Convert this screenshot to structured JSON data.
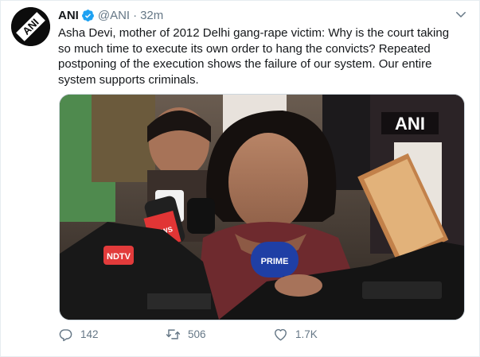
{
  "tweet": {
    "author": "ANI",
    "handle": "@ANI",
    "separator": "·",
    "time": "32m",
    "text": "Asha Devi, mother of 2012 Delhi gang-rape victim: Why is the court taking so much time to execute its own order to hang the convicts? Repeated postponing of the execution shows the failure of our system. Our entire system supports criminals.",
    "avatar_text": "ANI",
    "icons": {
      "verified": "verified-badge-icon",
      "caret": "chevron-down-icon",
      "reply": "reply-icon",
      "retweet": "retweet-icon",
      "like": "heart-icon"
    }
  },
  "media": {
    "watermark": "ANI",
    "mic_labels": [
      "NEWS",
      "PRIME",
      "NDTV"
    ]
  },
  "actions": {
    "reply_count": "142",
    "retweet_count": "506",
    "like_count": "1.7K"
  },
  "colors": {
    "primary_text": "#14171a",
    "secondary_text": "#657786",
    "verified_blue": "#1da1f2",
    "border": "#e6ecf0"
  }
}
